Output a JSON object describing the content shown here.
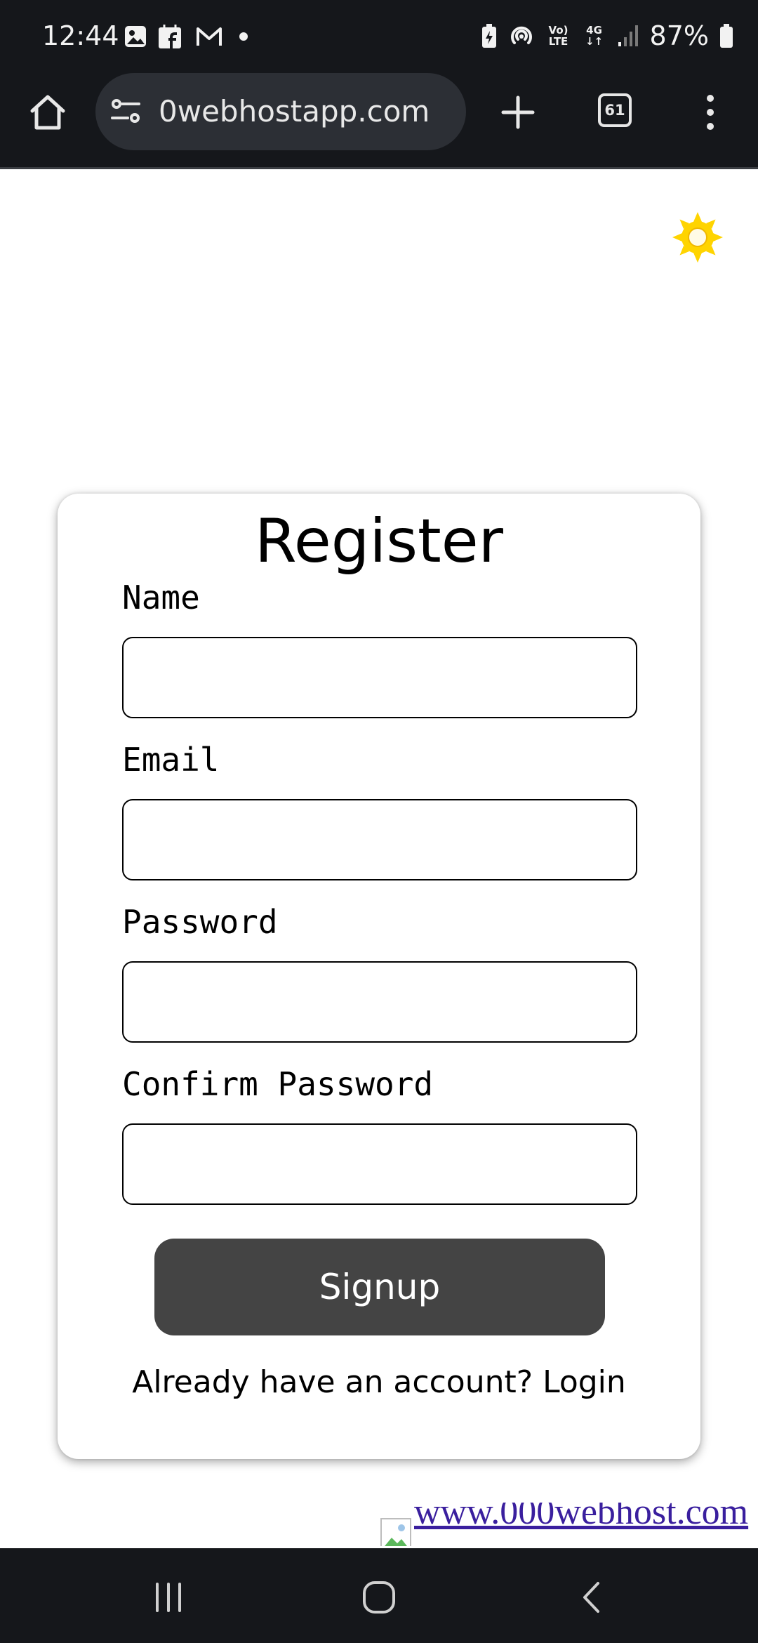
{
  "status_bar": {
    "time": "12:44",
    "battery_percent": "87%",
    "volte_label_top": "Vo)",
    "volte_label_bottom": "LTE",
    "network_label": "4G",
    "left_icons": [
      "gallery-icon",
      "facebook-notification-icon",
      "gmail-icon",
      "more-notifications-dot-icon"
    ],
    "right_icons": [
      "battery-saver-icon",
      "hotspot-icon",
      "volte-icon",
      "4g-data-icon",
      "signal-icon",
      "battery-icon"
    ]
  },
  "browser": {
    "url": "0webhostapp.com",
    "tab_count": "61",
    "icons": [
      "home-icon",
      "site-info-icon",
      "plus-icon",
      "tab-switcher-icon",
      "more-vert-icon"
    ]
  },
  "page": {
    "theme_icon": "sun-icon",
    "accent_color": "#ffd400",
    "title": "Register",
    "fields": [
      {
        "label": "Name",
        "value": ""
      },
      {
        "label": "Email",
        "value": ""
      },
      {
        "label": "Password",
        "value": ""
      },
      {
        "label": "Confirm Password",
        "value": ""
      }
    ],
    "signup_label": "Signup",
    "signup_color": "#444444",
    "login_prompt": "Already have an account? ",
    "login_link": "Login",
    "host_link": "www.000webhost.com"
  },
  "nav": {
    "icons": [
      "recent-apps-icon",
      "home-circle-icon",
      "back-icon"
    ]
  }
}
